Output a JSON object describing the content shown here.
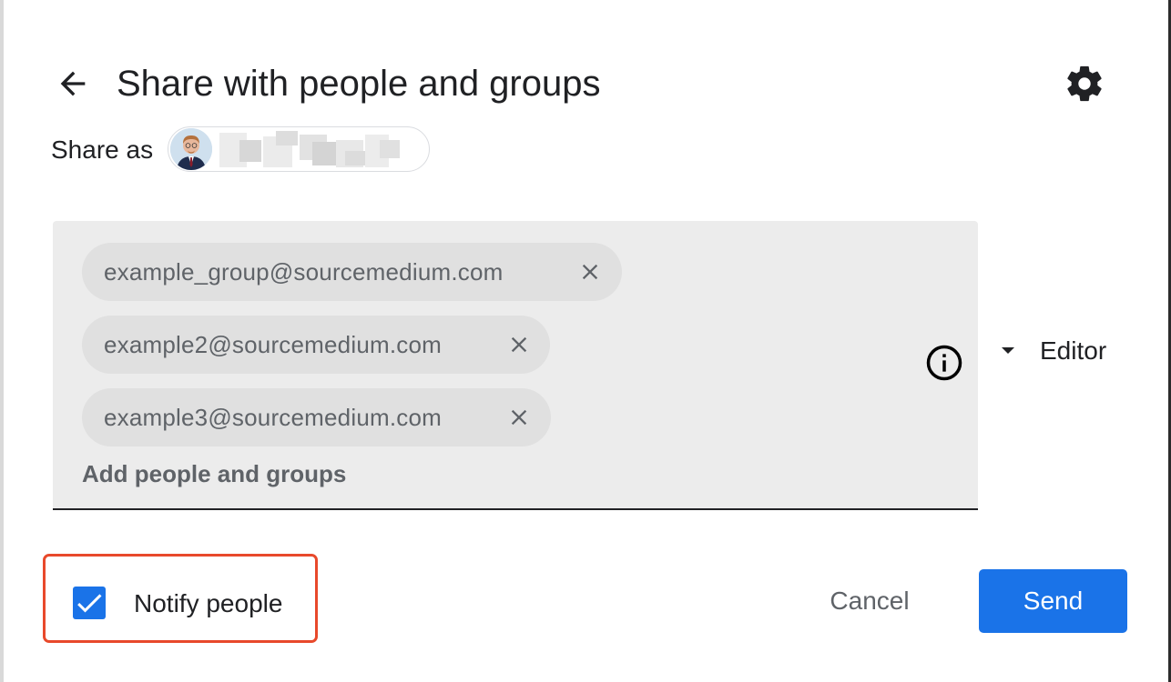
{
  "dialog": {
    "title": "Share with people and groups",
    "back_icon": "arrow-back-icon",
    "settings_icon": "gear-icon"
  },
  "share_as": {
    "label": "Share as",
    "avatar_icon": "user-avatar"
  },
  "recipients": {
    "chips": [
      {
        "email": "example_group@sourcemedium.com"
      },
      {
        "email": "example2@sourcemedium.com"
      },
      {
        "email": "example3@sourcemedium.com"
      }
    ],
    "placeholder": "Add people and groups",
    "info_icon": "info-icon"
  },
  "role": {
    "selected": "Editor"
  },
  "footer": {
    "notify_label": "Notify people",
    "notify_checked": true,
    "cancel_label": "Cancel",
    "send_label": "Send"
  },
  "colors": {
    "primary": "#1a73e8",
    "highlight": "#e8492b",
    "chip_bg": "#e0e0e0",
    "field_bg": "#ececec"
  }
}
